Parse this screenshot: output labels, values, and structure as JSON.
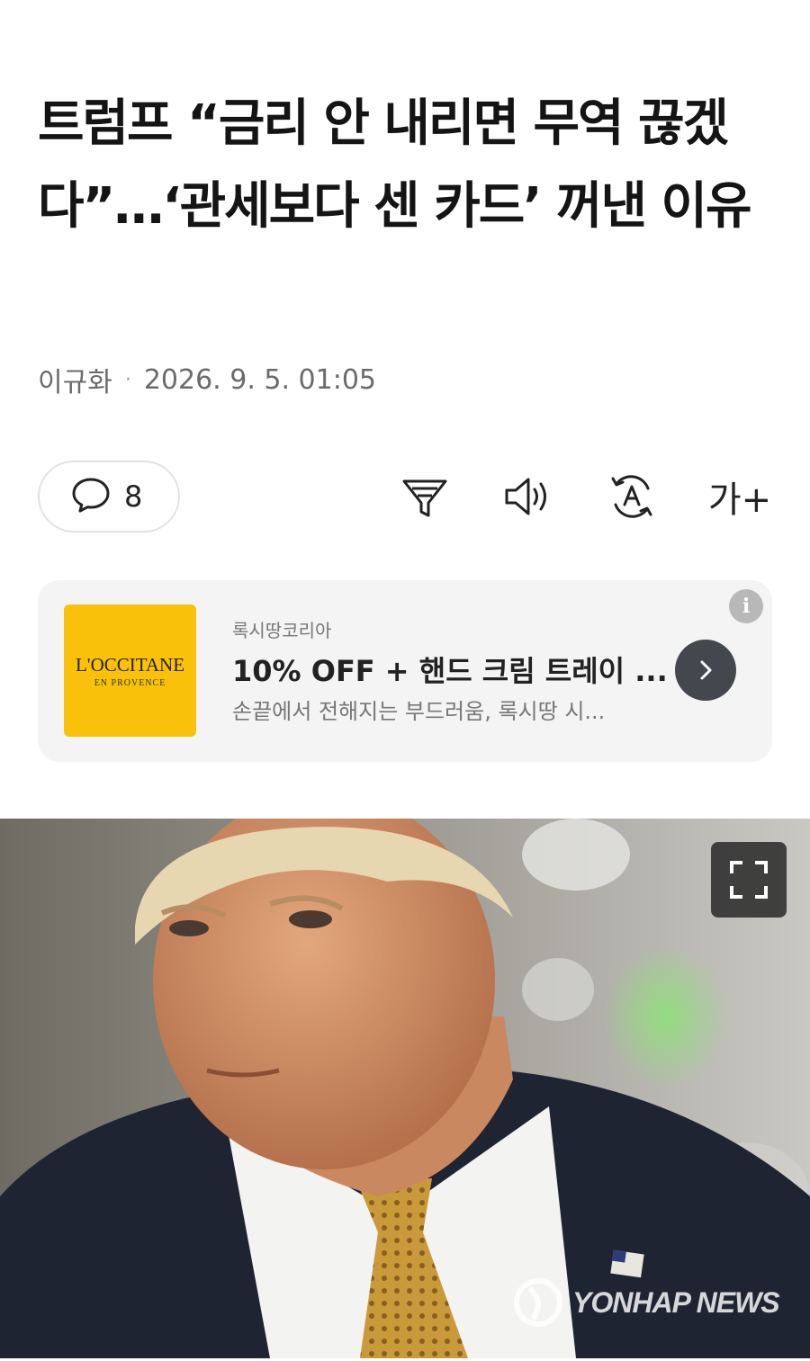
{
  "article": {
    "headline": "트럼프 “금리 안 내리면 무역 끊겠다”…‘관세보다 센 카드’ 꺼낸 이유",
    "author": "이규화",
    "separator": "·",
    "datetime": "2026. 9. 5. 01:05"
  },
  "toolbar": {
    "comment_count": "8",
    "icons": [
      "comment-icon",
      "summary-icon",
      "speaker-icon",
      "translate-icon",
      "font-size-icon"
    ],
    "font_size_label": "가+"
  },
  "ad": {
    "brand_logo": "L'OCCITANE",
    "brand_logo_sub": "EN PROVENCE",
    "advertiser": "록시땅코리아",
    "title": "10% OFF + 핸드 크림 트레이 ...",
    "description": "손끝에서 전해지는 부드러움, 록시땅 시...",
    "info_label": "i",
    "colors": {
      "logo_bg": "#f9c10a",
      "button_bg": "#44474d"
    }
  },
  "photo": {
    "watermark": "YONHAP NEWS",
    "icons": [
      "expand-icon"
    ]
  }
}
